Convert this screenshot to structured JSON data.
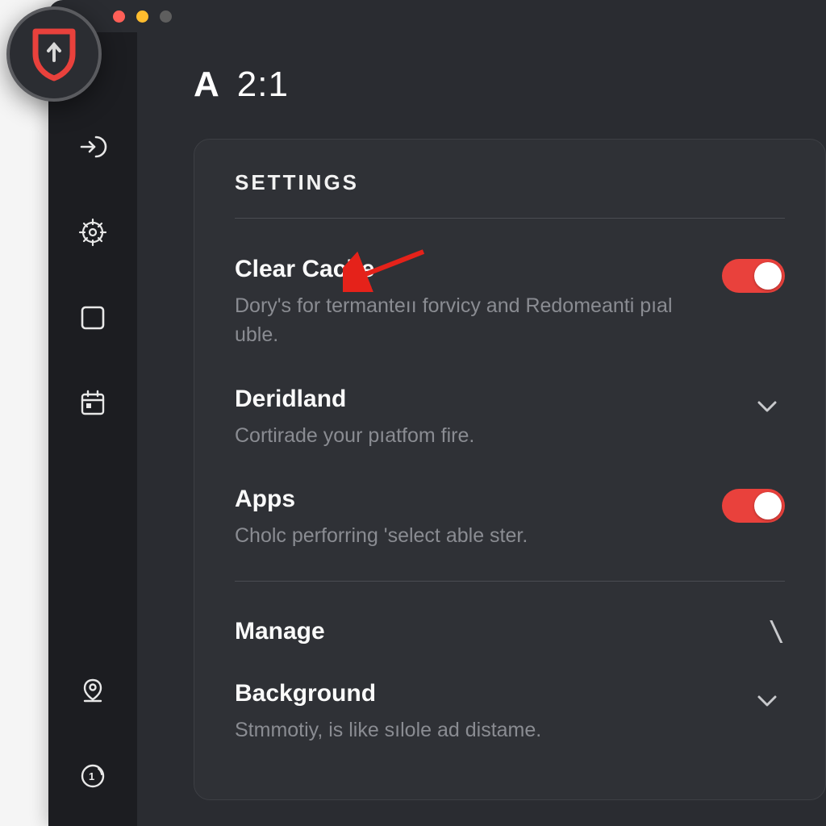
{
  "header": {
    "letter": "A",
    "time": "2:1"
  },
  "settings": {
    "title": "SETTINGS",
    "rows": [
      {
        "label": "Clear Cache",
        "desc": "Dory's for termanteıı forvicy and Redomeanti pıal uble.",
        "control": "toggle-on"
      },
      {
        "label": "Deridland",
        "desc": "Cortirade your pıatfom fire.",
        "control": "chevron"
      },
      {
        "label": "Apps",
        "desc": "Cholc perforring 'select able ster.",
        "control": "toggle-on"
      }
    ],
    "sections": [
      {
        "label": "Manage",
        "control": "backslash"
      },
      {
        "label": "Background",
        "desc": "Stmmotiy, is like sılole ad distame.",
        "control": "chevron"
      }
    ]
  },
  "colors": {
    "accent": "#e9413c",
    "bg_window": "#2a2c31",
    "bg_sidebar": "#1c1d21",
    "bg_card": "#2f3136"
  }
}
